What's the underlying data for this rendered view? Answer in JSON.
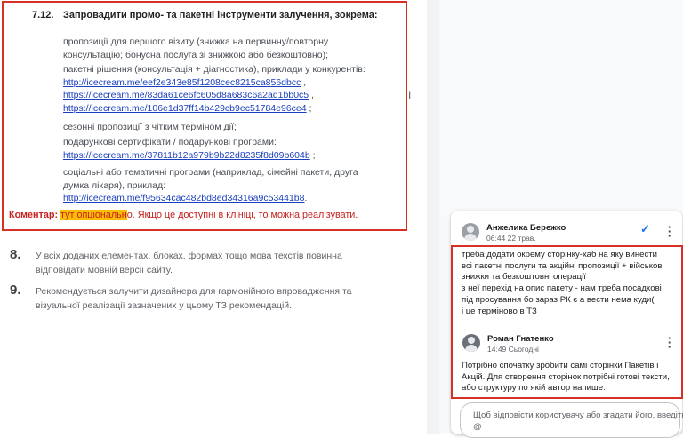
{
  "document": {
    "section": {
      "number": "7.12.",
      "title": "Запровадити промо- та пакетні інструменти залучення, зокрема:",
      "paragraphs": [
        {
          "lines": [
            "пропозиції для першого візиту (знижка на первинну/повторну",
            "консультацію; бонусна послуга зі знижкою або безкоштовно);"
          ]
        },
        {
          "lines": [
            "пакетні рішення (консультація + діагностика), приклади у конкурентів:"
          ],
          "links": [
            {
              "text": "http://icecream.me/eef2e343e85f1208cec8215ca856dbcc",
              "suffix": " ,"
            },
            {
              "text": "https://icecream.me/83da61ce6fc605d8a683c6a2ad1bb0c5",
              "suffix": " ,"
            },
            {
              "text": "https://icecream.me/106e1d37ff14b429cb9ec51784e96ce4",
              "suffix": " ;"
            }
          ]
        },
        {
          "lines": [
            "сезонні пропозиції з чітким терміном дії;"
          ]
        },
        {
          "lines": [
            "подарункові сертифікати / подарункові програми:"
          ],
          "links": [
            {
              "text": "https://icecream.me/37811b12a979b9b22d8235f8d09b604b",
              "suffix": " ;"
            }
          ]
        },
        {
          "lines": [
            "соціальні або тематичні програми (наприклад, сімейні пакети, друга",
            "думка лікаря), приклад:"
          ],
          "links": [
            {
              "text": "http://icecream.me/f95634cac482bd8ed34316a9c53441b8",
              "suffix": "."
            }
          ]
        }
      ]
    },
    "comment_line": {
      "label": "Коментар:",
      "highlight": "тут опціональн",
      "rest": "о. Якщо це доступні в клініці, то можна реалізувати."
    },
    "items": [
      {
        "number": "8.",
        "lines": [
          "У всіх доданих елементах, блоках, формах тощо мова текстів повинна",
          "відповідати мовній версії сайту."
        ]
      },
      {
        "number": "9.",
        "lines": [
          "Рекомендується залучити дизайнера для гармонійного впровадження та",
          "візуальної реалізації зазначених у цьому ТЗ рекомендацій."
        ]
      }
    ]
  },
  "comments": [
    {
      "author": "Анжелика Бережко",
      "time": "06:44 22 трав.",
      "lines": [
        "треба додати окрему сторінку-хаб на яку винести",
        "всі пакетні послуги та акційні пропозиції + військові",
        "знижки та безкоштовні операції",
        "з неї перехід на опис пакету - нам треба посадкові",
        "під просування бо зараз РК є а вести нема куди(",
        "і це терміново в ТЗ"
      ],
      "resolve_icon": "check-icon",
      "menu_icon": "more-vert-icon"
    },
    {
      "author": "Роман Гнатенко",
      "time": "14:49 Сьогодні",
      "lines": [
        "Потрібно спочатку зробити самі сторінки Пакетів і",
        "Акцій. Для створення сторінок потрібні готові тексти,",
        "або структуру по якій автор напише."
      ],
      "menu_icon": "more-vert-icon"
    }
  ],
  "reply": {
    "placeholder_lines": [
      "Щоб відповісти користувачу або згадати його, введіть",
      "@"
    ]
  },
  "colors": {
    "annotation_red": "#d93025",
    "highlight_yellow": "#fbbc04",
    "link_blue": "#1a3fbf",
    "accent_blue": "#1a73e8"
  }
}
